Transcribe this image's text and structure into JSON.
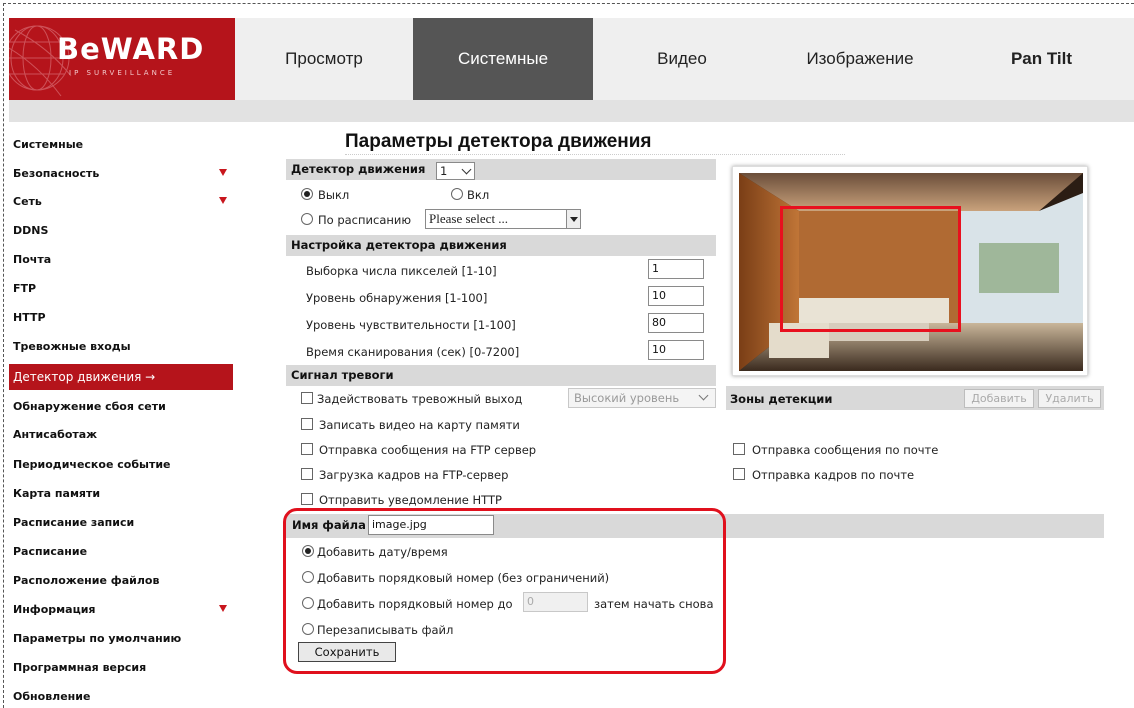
{
  "brand": {
    "logo_text": "BeWARD",
    "logo_sub": "IP SURVEILLANCE"
  },
  "colors": {
    "brand_red": "#b5141b",
    "active_tab": "#555555",
    "section_gray": "#d9d9d9",
    "highlight_red": "#e0101d"
  },
  "nav": {
    "tabs": [
      {
        "label": "Просмотр"
      },
      {
        "label": "Системные",
        "active": true
      },
      {
        "label": "Видео"
      },
      {
        "label": "Изображение"
      },
      {
        "label": "Pan Tilt"
      }
    ]
  },
  "sidebar": {
    "items": [
      {
        "label": "Системные"
      },
      {
        "label": "Безопасность",
        "expandable": true
      },
      {
        "label": "Сеть",
        "expandable": true
      },
      {
        "label": "DDNS"
      },
      {
        "label": "Почта"
      },
      {
        "label": "FTP"
      },
      {
        "label": "HTTP"
      },
      {
        "label": "Тревожные входы"
      },
      {
        "label": "Детектор движения →",
        "active": true
      },
      {
        "label": "Обнаружение сбоя сети"
      },
      {
        "label": "Антисаботаж"
      },
      {
        "label": "Периодическое событие"
      },
      {
        "label": "Карта памяти"
      },
      {
        "label": "Расписание записи"
      },
      {
        "label": "Расписание"
      },
      {
        "label": "Расположение файлов"
      },
      {
        "label": "Информация",
        "expandable": true
      },
      {
        "label": "Параметры по умолчанию"
      },
      {
        "label": "Программная версия"
      },
      {
        "label": "Обновление"
      }
    ]
  },
  "page": {
    "title": "Параметры детектора движения"
  },
  "detector": {
    "section_label": "Детектор движения",
    "selected": "1",
    "off_label": "Выкл",
    "on_label": "Вкл",
    "schedule_label": "По расписанию",
    "schedule_select": "Please select ..."
  },
  "settings": {
    "section_label": "Настройка детектора движения",
    "fields": [
      {
        "label": "Выборка числа пикселей [1-10]",
        "value": "1"
      },
      {
        "label": "Уровень обнаружения [1-100]",
        "value": "10"
      },
      {
        "label": "Уровень чувствительности [1-100]",
        "value": "80"
      },
      {
        "label": "Время сканирования (сек) [0-7200]",
        "value": "10"
      }
    ]
  },
  "alarm": {
    "section_label": "Сигнал тревоги",
    "trigger_output": "Задействовать тревожный выход",
    "level_select": "Высокий уровень",
    "record_sd": "Записать видео на карту памяти",
    "ftp_message": "Отправка сообщения на FTP сервер",
    "ftp_frames": "Загрузка кадров на FTP-сервер",
    "http_notify": "Отправить уведомление HTTP",
    "email_message": "Отправка сообщения по почте",
    "email_frames": "Отправка кадров по почте"
  },
  "zones": {
    "title": "Зоны детекции",
    "add_label": "Добавить",
    "delete_label": "Удалить"
  },
  "file": {
    "label": "Имя файла :",
    "value": "image.jpg",
    "opt_datetime": "Добавить дату/время",
    "opt_seq_unlimited": "Добавить порядковый номер (без ограничений)",
    "opt_seq_to": "Добавить порядковый номер до",
    "seq_to_value": "0",
    "restart_label": "затем начать снова",
    "opt_overwrite": "Перезаписывать файл",
    "save_label": "Сохранить"
  }
}
